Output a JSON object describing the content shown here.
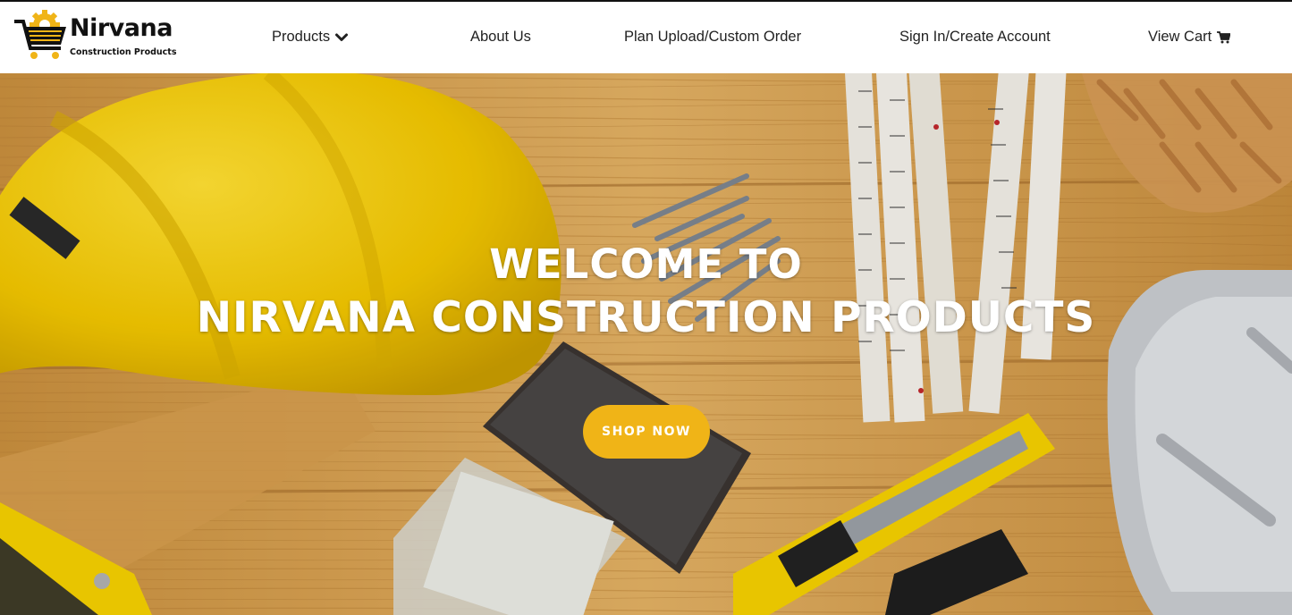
{
  "brand": {
    "name": "Nirvana",
    "tagline": "Construction Products"
  },
  "nav": {
    "products": "Products",
    "about": "About Us",
    "plan_upload": "Plan Upload/Custom Order",
    "signin": "Sign In/Create Account",
    "cart": "View Cart"
  },
  "icons": {
    "products_dropdown": "chevron-down-icon",
    "cart": "shopping-cart-icon",
    "logo": "cart-gear-logo"
  },
  "hero": {
    "title_line1": "WELCOME TO",
    "title_line2": "NIRVANA CONSTRUCTION PRODUCTS",
    "cta_label": "SHOP NOW"
  },
  "colors": {
    "accent": "#f0b417",
    "helmet": "#f2c600",
    "wood": "#d9a352",
    "nav_text": "#222222"
  }
}
